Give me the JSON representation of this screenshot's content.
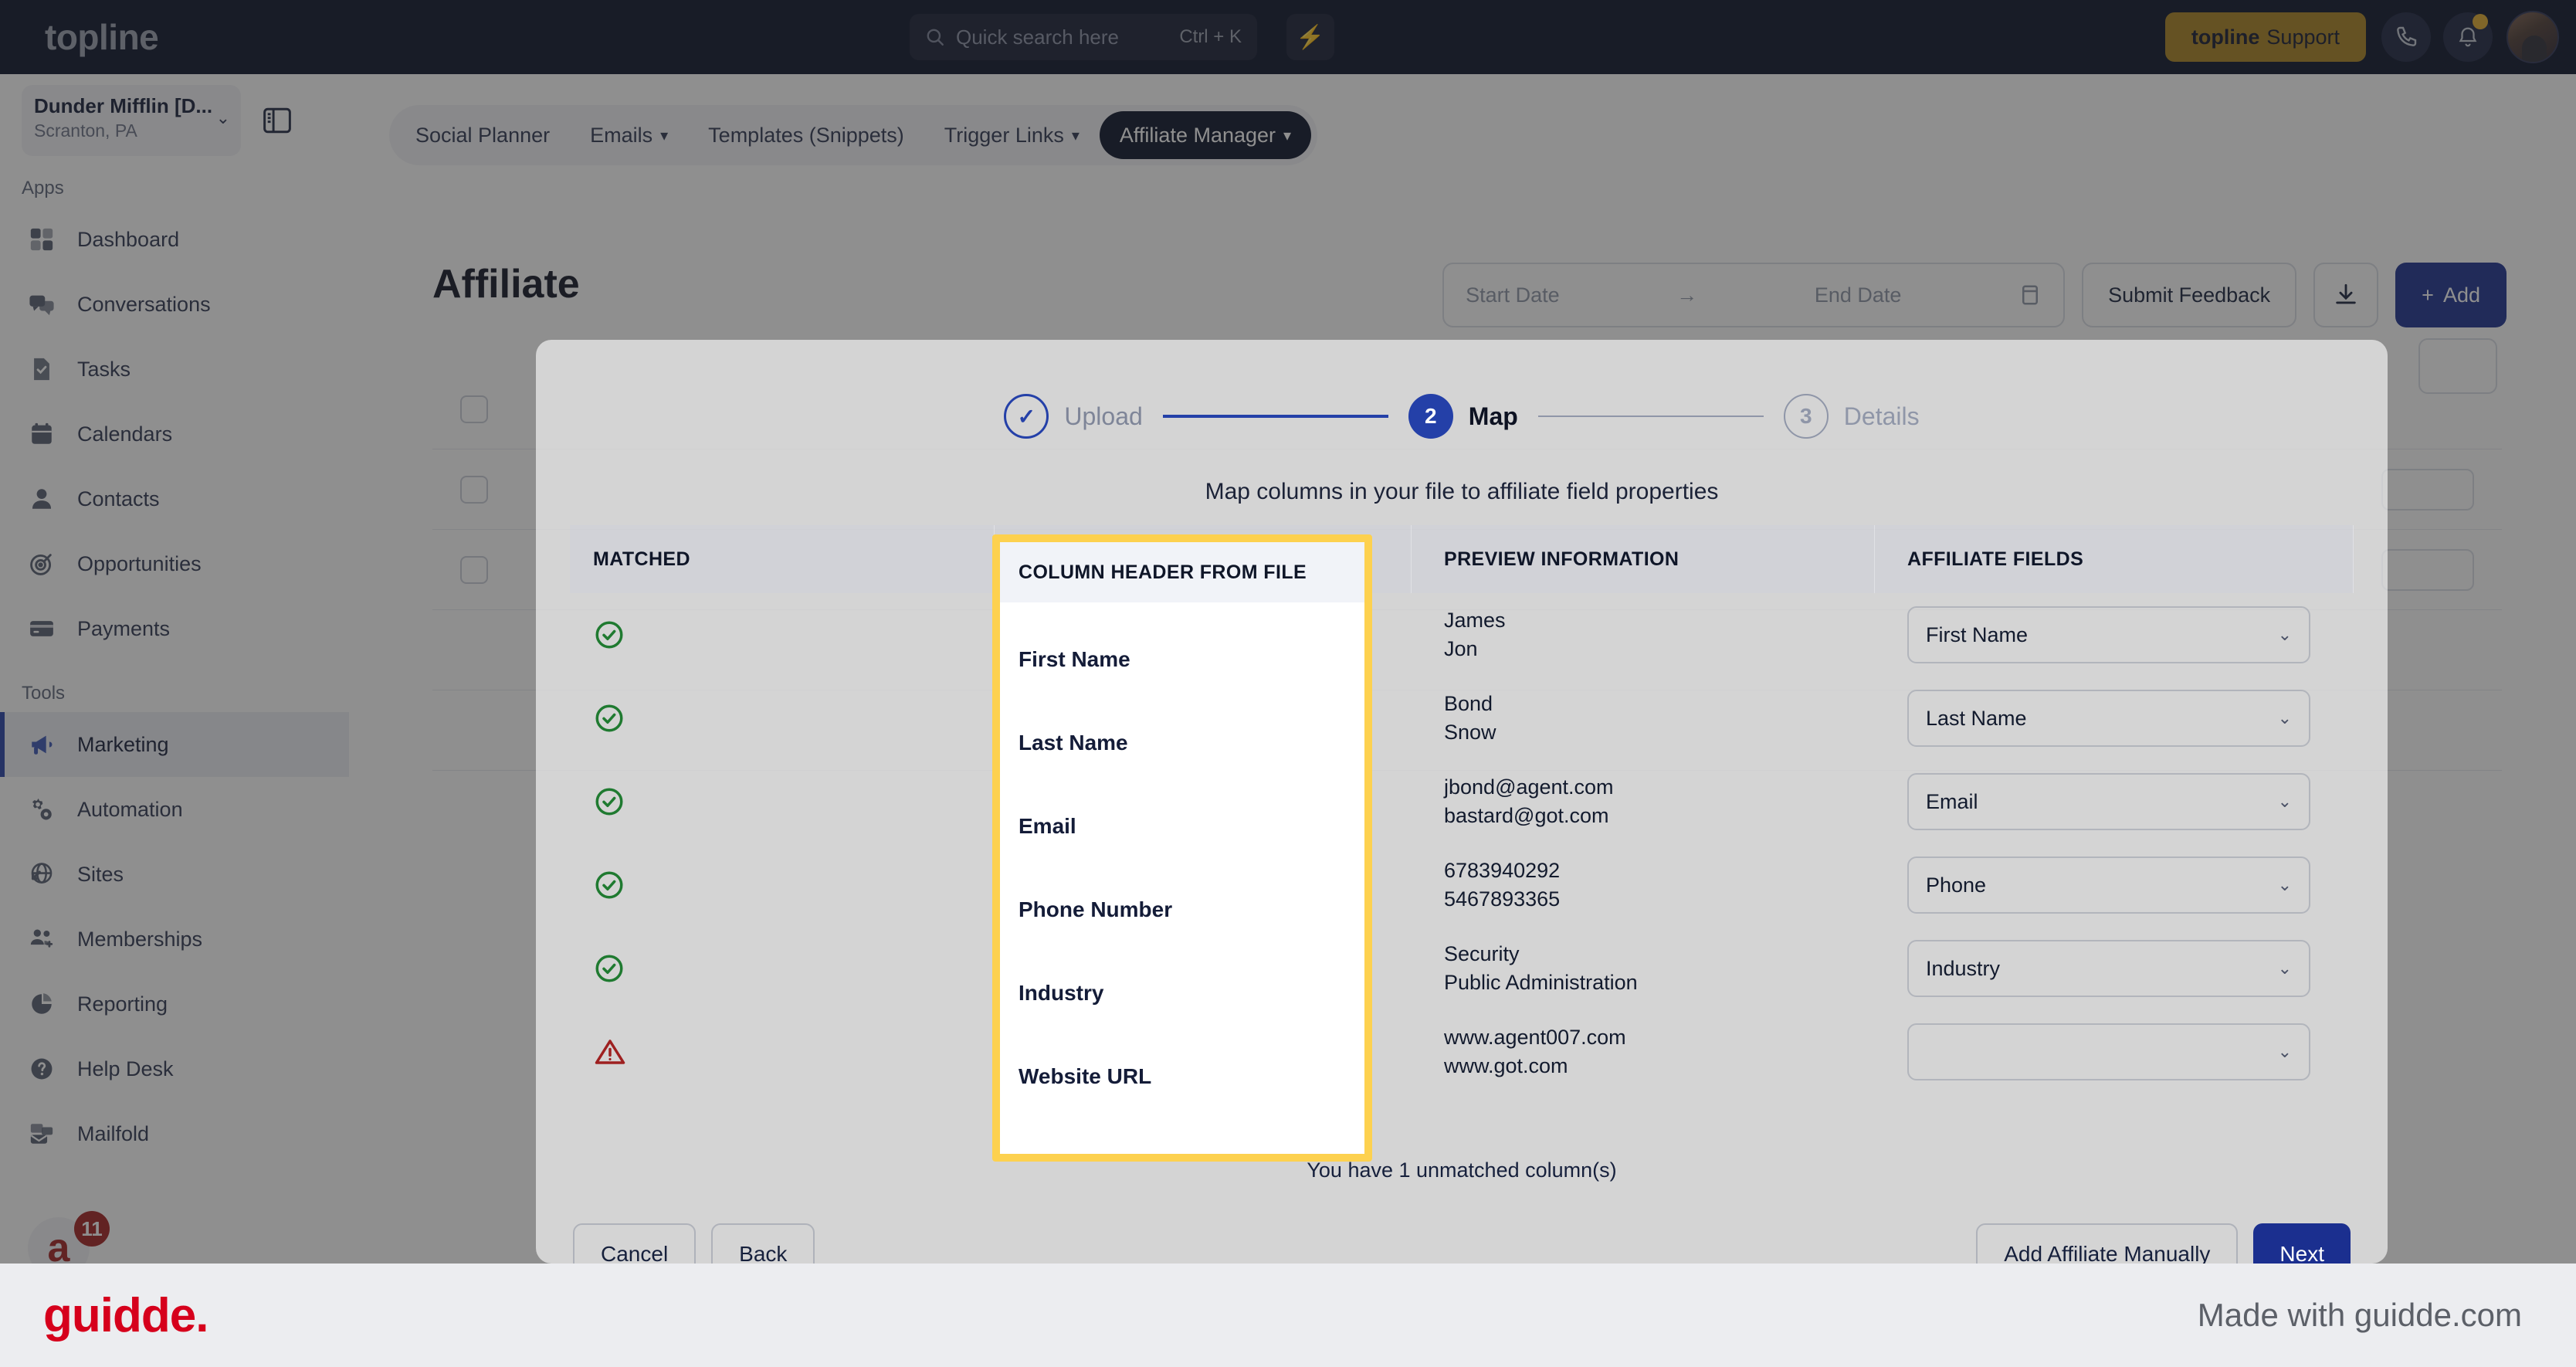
{
  "topbar": {
    "brand": "topline",
    "search": {
      "placeholder": "Quick search here",
      "shortcut": "Ctrl + K",
      "icon": "search-icon"
    },
    "bolt_icon": "lightning-bolt-icon",
    "support_button": {
      "brand": "topline",
      "label": "Support"
    },
    "phone_icon": "phone-icon",
    "bell_icon": "bell-icon",
    "avatar": "user-avatar"
  },
  "sidebar": {
    "org": {
      "name": "Dunder Mifflin [D...",
      "location": "Scranton, PA",
      "chevron": "chevron-down-icon"
    },
    "panel_toggle_icon": "panel-collapse-icon",
    "sections": [
      {
        "label": "Apps",
        "items": [
          {
            "label": "Dashboard",
            "icon": "dashboard-icon",
            "active": false
          },
          {
            "label": "Conversations",
            "icon": "conversations-icon",
            "active": false
          },
          {
            "label": "Tasks",
            "icon": "tasks-icon",
            "active": false
          },
          {
            "label": "Calendars",
            "icon": "calendar-icon",
            "active": false
          },
          {
            "label": "Contacts",
            "icon": "contacts-icon",
            "active": false
          },
          {
            "label": "Opportunities",
            "icon": "target-icon",
            "active": false
          },
          {
            "label": "Payments",
            "icon": "credit-card-icon",
            "active": false
          }
        ]
      },
      {
        "label": "Tools",
        "items": [
          {
            "label": "Marketing",
            "icon": "megaphone-icon",
            "active": true
          },
          {
            "label": "Automation",
            "icon": "gears-icon",
            "active": false
          },
          {
            "label": "Sites",
            "icon": "globe-icon",
            "active": false
          },
          {
            "label": "Memberships",
            "icon": "members-icon",
            "active": false
          },
          {
            "label": "Reporting",
            "icon": "pie-chart-icon",
            "active": false
          },
          {
            "label": "Help Desk",
            "icon": "question-circle-icon",
            "active": false
          },
          {
            "label": "Mailfold",
            "icon": "mail-stack-icon",
            "active": false
          }
        ]
      }
    ],
    "mailfold_badge": "11"
  },
  "subnav": {
    "items": [
      {
        "label": "Social Planner",
        "caret": false,
        "active": false
      },
      {
        "label": "Emails",
        "caret": true,
        "active": false
      },
      {
        "label": "Templates (Snippets)",
        "caret": false,
        "active": false
      },
      {
        "label": "Trigger Links",
        "caret": true,
        "active": false
      },
      {
        "label": "Affiliate Manager",
        "caret": true,
        "active": true
      }
    ]
  },
  "page": {
    "title": "Affiliate",
    "date_range": {
      "start_placeholder": "Start Date",
      "end_placeholder": "End Date",
      "arrow": "arrow-right-icon",
      "calendar_icon": "calendar-icon"
    },
    "submit_feedback": "Submit Feedback",
    "download_icon": "download-icon",
    "add_button": {
      "label": "Add",
      "icon": "plus-icon"
    }
  },
  "modal": {
    "steps": [
      {
        "number": "1",
        "label": "Upload",
        "state": "done",
        "check": "check-icon"
      },
      {
        "number": "2",
        "label": "Map",
        "state": "current"
      },
      {
        "number": "3",
        "label": "Details",
        "state": "todo"
      }
    ],
    "subtitle": "Map columns in your file to affiliate field properties",
    "columns": {
      "matched": "MATCHED",
      "header_from_file": "COLUMN HEADER FROM FILE",
      "preview": "PREVIEW INFORMATION",
      "affiliate_fields": "AFFILIATE FIELDS"
    },
    "rows": [
      {
        "matched": true,
        "match_icon": "check-circle-icon",
        "column_header": "First Name",
        "preview": [
          "James",
          "Jon"
        ],
        "affiliate_field": "First Name"
      },
      {
        "matched": true,
        "match_icon": "check-circle-icon",
        "column_header": "Last Name",
        "preview": [
          "Bond",
          "Snow"
        ],
        "affiliate_field": "Last Name"
      },
      {
        "matched": true,
        "match_icon": "check-circle-icon",
        "column_header": "Email",
        "preview": [
          "jbond@agent.com",
          "bastard@got.com"
        ],
        "affiliate_field": "Email"
      },
      {
        "matched": true,
        "match_icon": "check-circle-icon",
        "column_header": "Phone Number",
        "preview": [
          "6783940292",
          "5467893365"
        ],
        "affiliate_field": "Phone"
      },
      {
        "matched": true,
        "match_icon": "check-circle-icon",
        "column_header": "Industry",
        "preview": [
          "Security",
          "Public Administration"
        ],
        "affiliate_field": "Industry"
      },
      {
        "matched": false,
        "match_icon": "warning-triangle-icon",
        "column_header": "Website URL",
        "preview": [
          "www.agent007.com",
          "www.got.com"
        ],
        "affiliate_field": ""
      }
    ],
    "unmatched_note": "You have 1 unmatched column(s)",
    "footer": {
      "cancel": "Cancel",
      "back": "Back",
      "add_manually": "Add Affiliate Manually",
      "next": "Next"
    }
  },
  "highlight": {
    "color": "#fdd14f"
  },
  "footer": {
    "logo": "guidde.",
    "made_with": "Made with guidde.com"
  },
  "colors": {
    "topbar_bg": "#080f26",
    "accent_blue": "#1b2f8f",
    "support_gold": "#a8811f",
    "success_green": "#1f7a30",
    "warning_red": "#9e2020",
    "guidde_red": "#d6001c",
    "highlight_yellow": "#fdd14f"
  }
}
